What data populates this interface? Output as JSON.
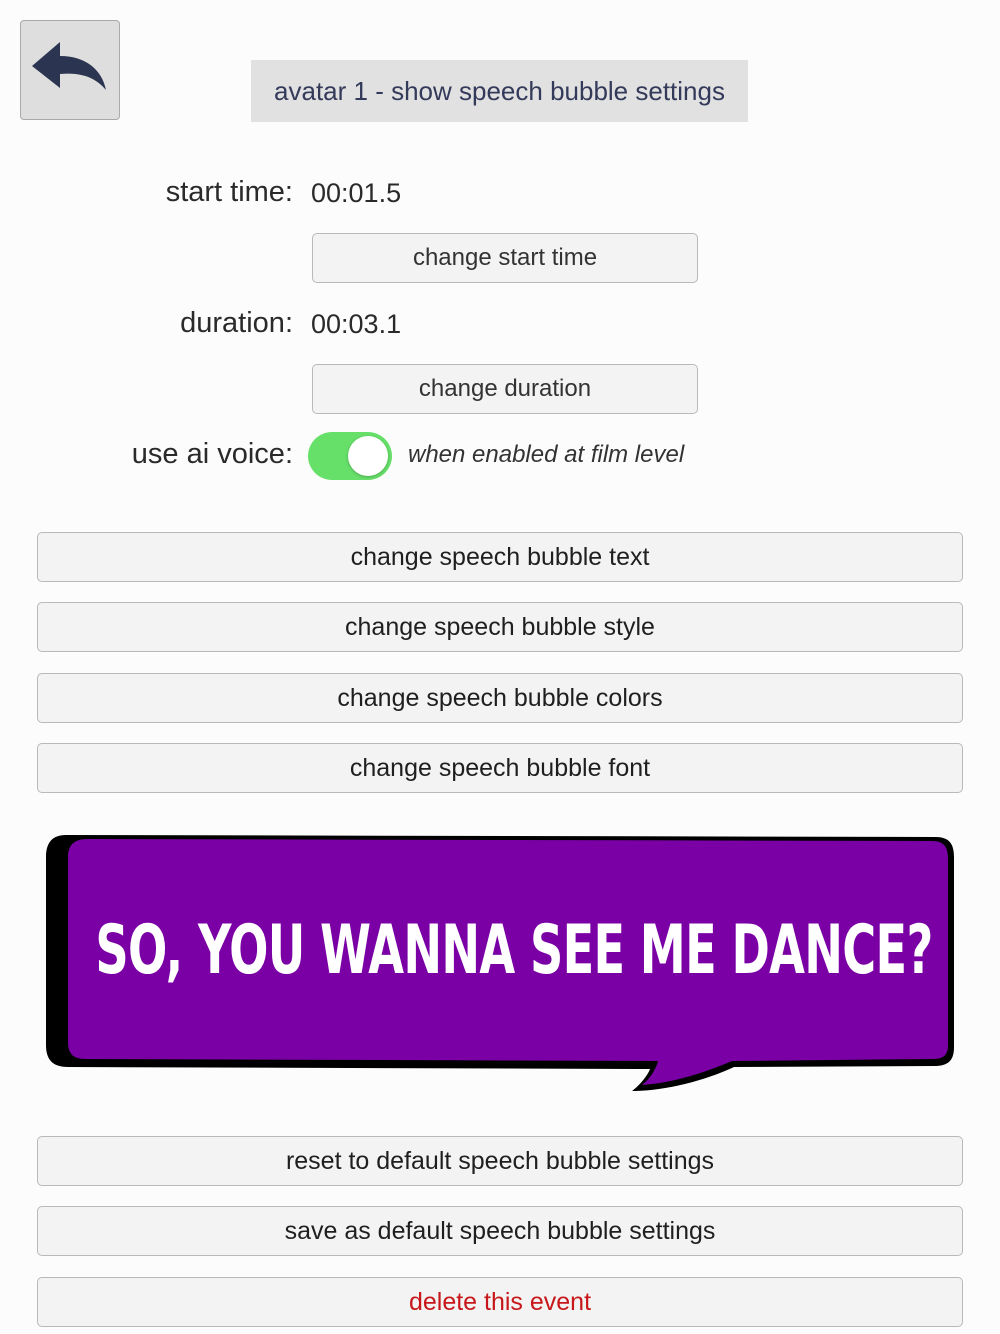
{
  "header": {
    "back_icon": "back-arrow-icon",
    "title": "avatar 1 - show speech bubble settings"
  },
  "timing": {
    "start_label": "start time:",
    "start_value": "00:01.5",
    "change_start_label": "change start time",
    "duration_label": "duration:",
    "duration_value": "00:03.1",
    "change_duration_label": "change duration"
  },
  "voice": {
    "label": "use ai voice:",
    "enabled": true,
    "note": "when enabled at film level",
    "toggle_color": "#67e06a"
  },
  "bubble_buttons": [
    "change speech bubble text",
    "change speech bubble style",
    "change speech bubble colors",
    "change speech bubble font"
  ],
  "preview": {
    "text": "SO, YOU WANNA SEE ME DANCE?",
    "fill_color": "#7a00a6",
    "outline_color": "#000000",
    "text_color": "#ffffff"
  },
  "footer_buttons": {
    "reset": "reset to default speech bubble settings",
    "save": "save as default speech bubble settings",
    "delete": "delete this event"
  }
}
